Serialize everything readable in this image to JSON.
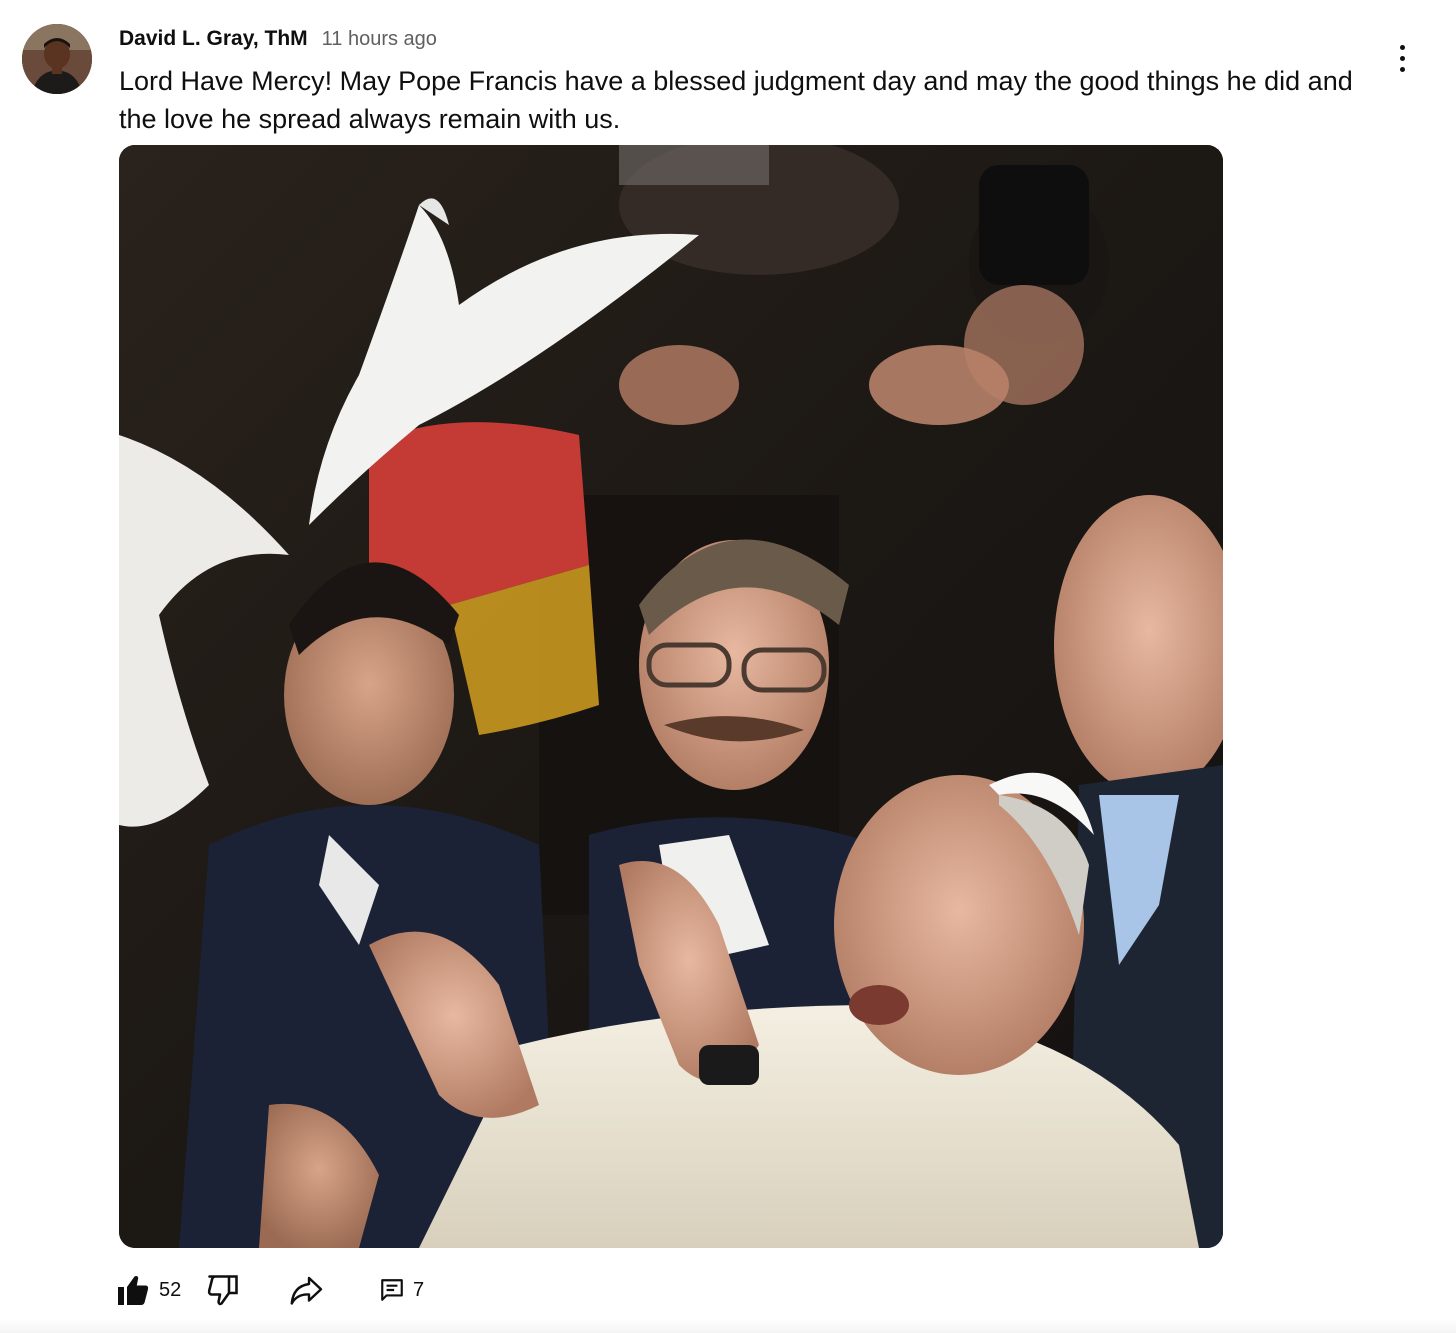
{
  "comment": {
    "author": "David L. Gray, ThM",
    "timestamp": "11 hours ago",
    "text": "Lord Have Mercy! May Pope Francis have a blessed judgment day and may the good things he did and the love he spread always remain with us.",
    "avatar_icon": "user-avatar",
    "more_icon": "more-vertical-icon",
    "image_icon": "attached-photo"
  },
  "actions": {
    "like_icon": "thumbs-up-filled-icon",
    "like_count": "52",
    "dislike_icon": "thumbs-down-icon",
    "share_icon": "share-arrow-icon",
    "reply_icon": "comment-icon",
    "reply_count": "7"
  },
  "colors": {
    "text_primary": "#0f0f0f",
    "text_secondary": "#606060",
    "background": "#ffffff"
  }
}
